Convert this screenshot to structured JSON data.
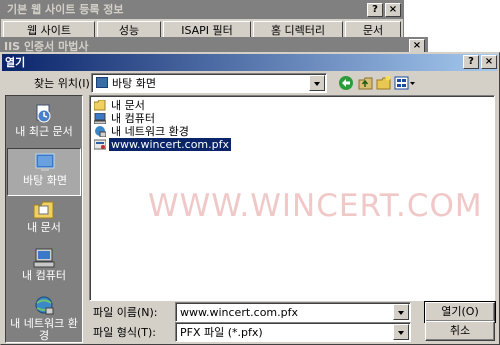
{
  "win1": {
    "title": "기본 웹 사이트 등록 정보",
    "tabs": [
      "웹 사이트",
      "성능",
      "ISAPI 필터",
      "홈 디렉터리",
      "문서"
    ]
  },
  "win2": {
    "title": "IIS 인증서 마법사"
  },
  "dialog": {
    "title": "열기",
    "look_in_label": "찾는 위치(I):",
    "look_in_value": "바탕 화면",
    "places": [
      {
        "label": "내 최근 문서",
        "icon": "recent-documents-icon"
      },
      {
        "label": "바탕 화면",
        "icon": "desktop-icon"
      },
      {
        "label": "내 문서",
        "icon": "my-documents-folder-icon"
      },
      {
        "label": "내 컴퓨터",
        "icon": "my-computer-icon"
      },
      {
        "label": "내 네트워크 환경",
        "icon": "network-places-icon"
      }
    ],
    "files": [
      {
        "name": "내 문서",
        "icon": "folder-icon"
      },
      {
        "name": "내 컴퓨터",
        "icon": "computer-icon"
      },
      {
        "name": "내 네트워크 환경",
        "icon": "network-icon"
      },
      {
        "name": "www.wincert.com.pfx",
        "icon": "certificate-file-icon",
        "selected": true
      }
    ],
    "watermark": "WWW.WINCERT.COM",
    "filename_label": "파일 이름(N):",
    "filename_value": "www.wincert.com.pfx",
    "filetype_label": "파일 형식(T):",
    "filetype_value": "PFX 파일 (*.pfx)",
    "open_button": "열기(O)",
    "cancel_button": "취소"
  },
  "colors": {
    "titlebar_active": "#0a246a",
    "titlebar_inactive": "#808080",
    "face": "#d4d0c8",
    "selection": "#0a246a"
  }
}
